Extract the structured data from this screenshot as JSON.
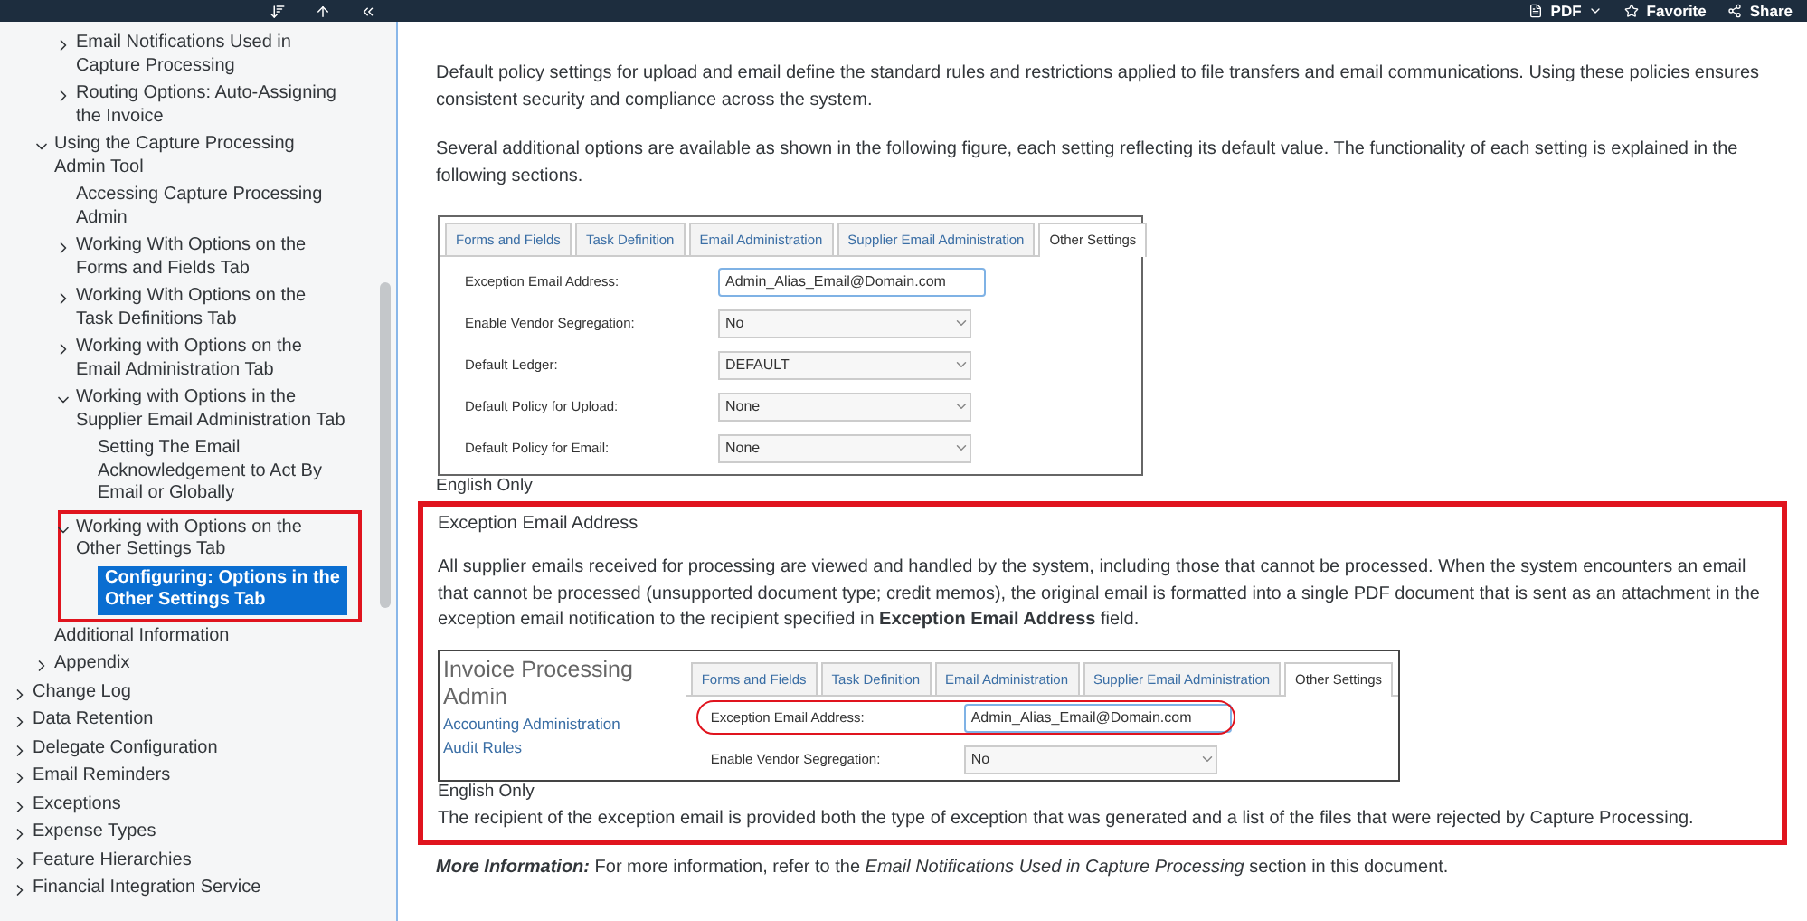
{
  "toolbar": {
    "pdf": "PDF",
    "favorite": "Favorite",
    "share": "Share"
  },
  "sidebar": {
    "tree": [
      {
        "children": [
          {
            "children": [
              {
                "label": "Email Notifications Used in Capture Processing",
                "expanded": false,
                "selected": false
              },
              {
                "label": "Routing Options: Auto-Assigning the Invoice",
                "expanded": false,
                "selected": false
              }
            ]
          },
          {
            "label": "Using the Capture Processing Admin Tool",
            "expanded": true,
            "selected": false,
            "children": [
              {
                "label": "Accessing Capture Processing Admin",
                "selected": false
              },
              {
                "label": "Working With Options on the Forms and Fields Tab",
                "expanded": false,
                "selected": false
              },
              {
                "label": "Working With Options on the Task Definitions Tab",
                "expanded": false,
                "selected": false
              },
              {
                "label": "Working with Options on the Email Administration Tab",
                "expanded": false,
                "selected": false
              },
              {
                "label": "Working with Options in the Supplier Email Administration Tab",
                "expanded": true,
                "selected": false,
                "children": [
                  {
                    "label": "Setting The Email Acknowledgement to Act By Email or Globally",
                    "selected": false
                  }
                ]
              },
              {
                "label": "Working with Options on the Other Settings Tab",
                "expanded": true,
                "selected": false,
                "annotated": true,
                "children": [
                  {
                    "label": "Configuring: Options in the Other Settings Tab",
                    "selected": true
                  }
                ]
              }
            ]
          },
          {
            "label": "Additional Information",
            "selected": false
          },
          {
            "label": "Appendix",
            "expanded": false,
            "selected": false
          }
        ]
      },
      {
        "label": "Change Log",
        "expanded": false,
        "selected": false
      },
      {
        "label": "Data Retention",
        "expanded": false,
        "selected": false
      },
      {
        "label": "Delegate Configuration",
        "expanded": false,
        "selected": false
      },
      {
        "label": "Email Reminders",
        "expanded": false,
        "selected": false
      },
      {
        "label": "Exceptions",
        "expanded": false,
        "selected": false
      },
      {
        "label": "Expense Types",
        "expanded": false,
        "selected": false
      },
      {
        "label": "Feature Hierarchies",
        "expanded": false,
        "selected": false
      },
      {
        "label": "Financial Integration Service",
        "expanded": false,
        "selected": false
      }
    ]
  },
  "content": {
    "paragraphs": [
      "Default policy settings for upload and email define the standard rules and restrictions applied to file transfers and email communications. Using these policies ensures consistent security and compliance across the system.",
      "Several additional options are available as shown in the following figure, each setting reflecting its default value. The functionality of each setting is explained in the following sections."
    ],
    "figure_1": {
      "tabs": [
        {
          "label": "Forms and Fields",
          "selected": false
        },
        {
          "label": "Task Definition",
          "selected": false
        },
        {
          "label": "Email Administration",
          "selected": false
        },
        {
          "label": "Supplier Email Administration",
          "selected": false
        },
        {
          "label": "Other Settings",
          "selected": true
        }
      ],
      "rows": [
        {
          "kind": "text",
          "label": "Exception Email Address:",
          "value": "Admin_Alias_Email@Domain.com"
        },
        {
          "kind": "select",
          "label": "Enable Vendor Segregation:",
          "value": "No"
        },
        {
          "kind": "select",
          "label": "Default Ledger:",
          "value": "DEFAULT"
        },
        {
          "kind": "select",
          "label": "Default Policy for Upload:",
          "value": "None"
        },
        {
          "kind": "select",
          "label": "Default Policy for Email:",
          "value": "None"
        }
      ],
      "caption": "English Only"
    },
    "section": {
      "annotated": true,
      "title": "Exception Email Address",
      "body": "All supplier emails received for processing are viewed and handled by the system, including those that cannot be processed. When the system encounters an email that cannot be processed (unsupported document type; credit memos), the original email is formatted into a single PDF document that is sent as an attachment in the exception email notification to the recipient specified in **Exception Email Address** field.",
      "figure_2": {
        "app_title": "Invoice Processing Admin",
        "nav_links": [
          "Accounting Administration",
          "Audit Rules"
        ],
        "tabs": [
          {
            "label": "Forms and Fields",
            "selected": false
          },
          {
            "label": "Task Definition",
            "selected": false
          },
          {
            "label": "Email Administration",
            "selected": false
          },
          {
            "label": "Supplier Email Administration",
            "selected": false
          },
          {
            "label": "Other Settings",
            "selected": true
          }
        ],
        "rows": [
          {
            "kind": "text",
            "label": "Exception Email Address:",
            "value": "Admin_Alias_Email@Domain.com",
            "circled": true
          },
          {
            "kind": "select",
            "label": "Enable Vendor Segregation:",
            "value": "No"
          }
        ],
        "caption": "English Only"
      },
      "footer": "The recipient of the exception email is provided both the type of exception that was generated and a list of the files that were rejected by Capture Processing."
    },
    "more_info": {
      "label": "More Information:",
      "text": "For more information, refer to the *Email Notifications Used in Capture Processing* section in this document."
    }
  }
}
